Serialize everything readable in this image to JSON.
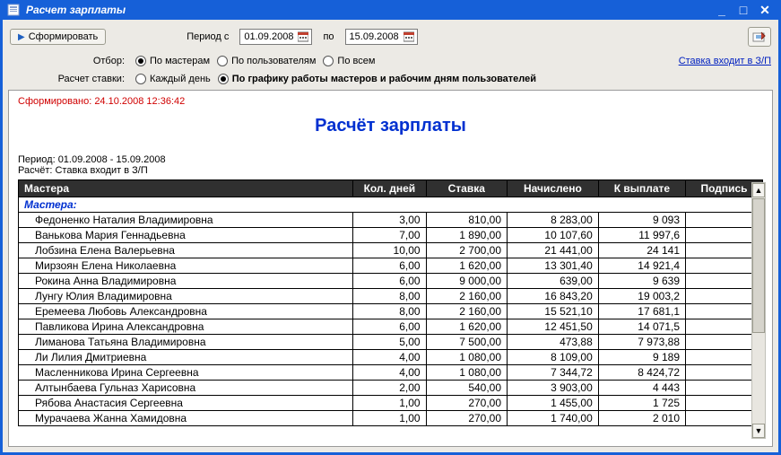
{
  "window": {
    "title": "Расчет зарплаты"
  },
  "toolbar": {
    "form_button": "Сформировать",
    "period_label": "Период с",
    "date_from": "01.09.2008",
    "to_label": "по",
    "date_to": "15.09.2008"
  },
  "filter": {
    "label": "Отбор:",
    "by_masters": "По мастерам",
    "by_users": "По пользователям",
    "by_all": "По всем",
    "selected": "by_masters",
    "rate_link": "Ставка входит в З/П"
  },
  "rate_calc": {
    "label": "Расчет ставки:",
    "every_day": "Каждый день",
    "by_schedule": "По графику работы мастеров и рабочим дням пользователей",
    "selected": "by_schedule"
  },
  "report": {
    "formed": "Сформировано: 24.10.2008 12:36:42",
    "title": "Расчёт зарплаты",
    "period_line": "Период: 01.09.2008 - 15.09.2008",
    "calc_line": "Расчёт: Ставка входит в З/П",
    "headers": [
      "Мастера",
      "Кол. дней",
      "Ставка",
      "Начислено",
      "К выплате",
      "Подпись"
    ],
    "group": "Мастера:",
    "rows": [
      {
        "name": "Федоненко Наталия Владимировна",
        "days": "3,00",
        "rate": "810,00",
        "accrued": "8 283,00",
        "payout": "9 093"
      },
      {
        "name": "Ванькова Мария Геннадьевна",
        "days": "7,00",
        "rate": "1 890,00",
        "accrued": "10 107,60",
        "payout": "11 997,6"
      },
      {
        "name": "Лобзина Елена Валерьевна",
        "days": "10,00",
        "rate": "2 700,00",
        "accrued": "21 441,00",
        "payout": "24 141"
      },
      {
        "name": "Мирзоян Елена Николаевна",
        "days": "6,00",
        "rate": "1 620,00",
        "accrued": "13 301,40",
        "payout": "14 921,4"
      },
      {
        "name": "Рокина Анна Владимировна",
        "days": "6,00",
        "rate": "9 000,00",
        "accrued": "639,00",
        "payout": "9 639"
      },
      {
        "name": "Лунгу Юлия Владимировна",
        "days": "8,00",
        "rate": "2 160,00",
        "accrued": "16 843,20",
        "payout": "19 003,2"
      },
      {
        "name": "Еремеева Любовь Александровна",
        "days": "8,00",
        "rate": "2 160,00",
        "accrued": "15 521,10",
        "payout": "17 681,1"
      },
      {
        "name": "Павликова Ирина Александровна",
        "days": "6,00",
        "rate": "1 620,00",
        "accrued": "12 451,50",
        "payout": "14 071,5"
      },
      {
        "name": "Лиманова  Татьяна  Владимировна",
        "days": "5,00",
        "rate": "7 500,00",
        "accrued": "473,88",
        "payout": "7 973,88"
      },
      {
        "name": "Ли Лилия Дмитриевна",
        "days": "4,00",
        "rate": "1 080,00",
        "accrued": "8 109,00",
        "payout": "9 189"
      },
      {
        "name": "Масленникова Ирина Сергеевна",
        "days": "4,00",
        "rate": "1 080,00",
        "accrued": "7 344,72",
        "payout": "8 424,72"
      },
      {
        "name": "Алтынбаева Гульназ Харисовна",
        "days": "2,00",
        "rate": "540,00",
        "accrued": "3 903,00",
        "payout": "4 443"
      },
      {
        "name": "Рябова Анастасия Сергеевна",
        "days": "1,00",
        "rate": "270,00",
        "accrued": "1 455,00",
        "payout": "1 725"
      },
      {
        "name": "Мурачаева Жанна Хамидовна",
        "days": "1,00",
        "rate": "270,00",
        "accrued": "1 740,00",
        "payout": "2 010"
      }
    ]
  }
}
